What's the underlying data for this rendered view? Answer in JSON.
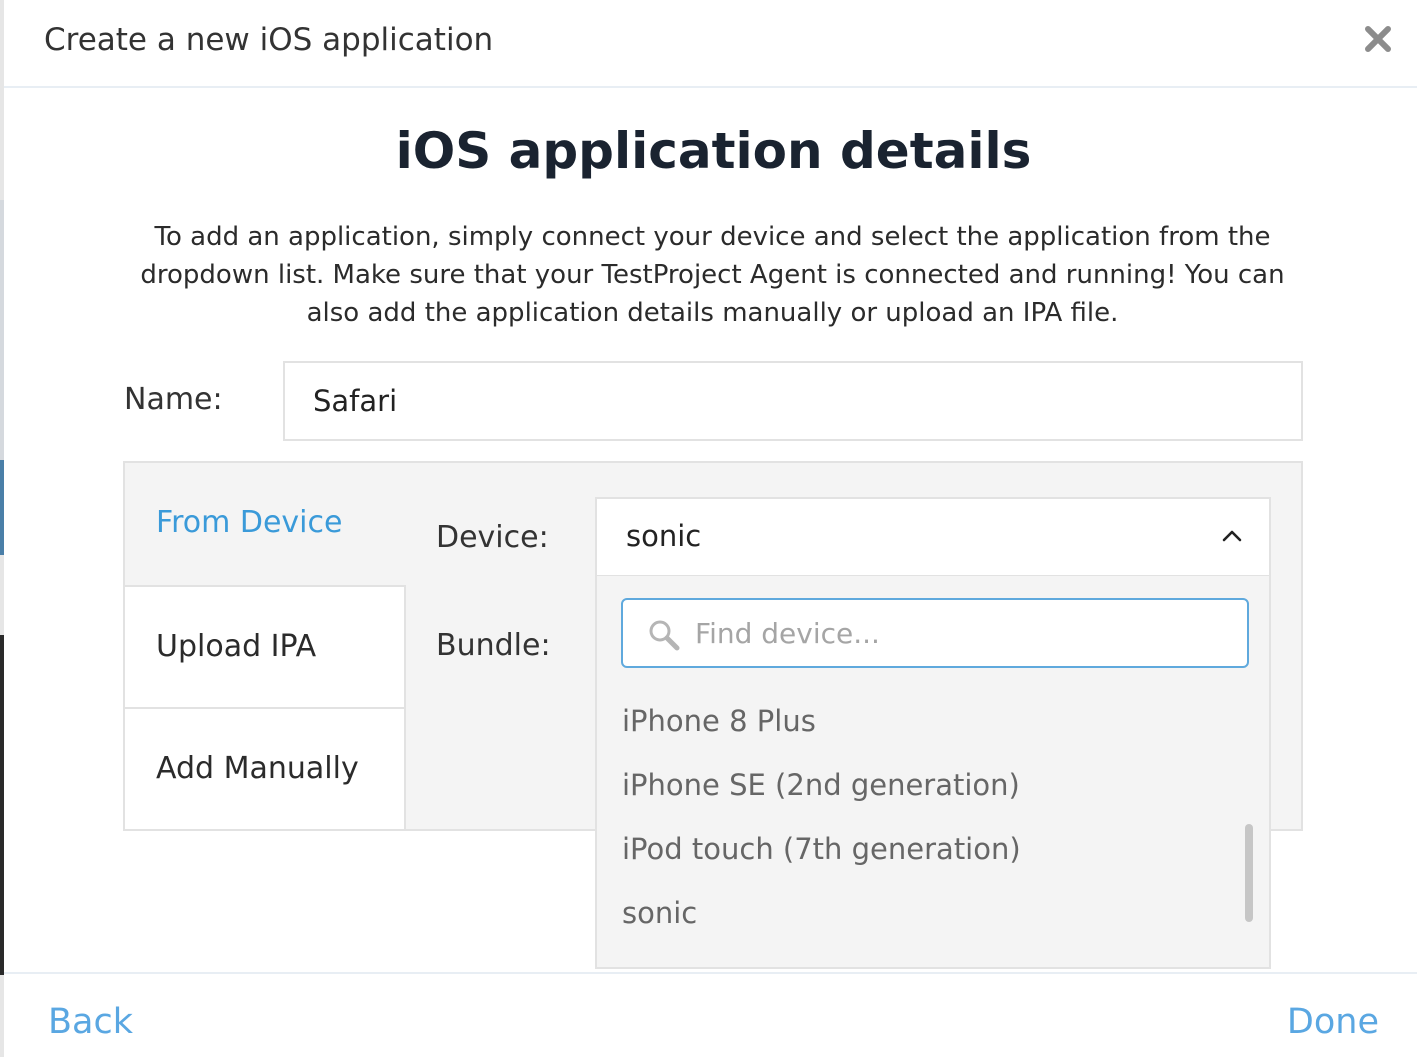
{
  "dialog": {
    "title": "Create a new iOS application",
    "close_icon": "close-icon"
  },
  "content": {
    "heading": "iOS application details",
    "description": "To add an application, simply connect your device and select the application from the dropdown list. Make sure that your TestProject Agent is connected and running! You can also add the application details manually or upload an IPA file."
  },
  "name_field": {
    "label": "Name:",
    "value": "Safari"
  },
  "tabs": [
    {
      "label": "From Device",
      "active": true
    },
    {
      "label": "Upload IPA",
      "active": false
    },
    {
      "label": "Add Manually",
      "active": false
    }
  ],
  "device_field": {
    "label": "Device:",
    "selected": "sonic",
    "icon": "chevron-up-icon",
    "search_placeholder": "Find device...",
    "search_icon": "search-icon",
    "options": [
      "iPhone 8 Plus",
      "iPhone SE (2nd generation)",
      "iPod touch (7th generation)",
      "sonic"
    ]
  },
  "bundle_field": {
    "label": "Bundle:"
  },
  "footer": {
    "back_label": "Back",
    "done_label": "Done"
  },
  "colors": {
    "accent": "#5aa7e2",
    "active_tab": "#3a9ad9",
    "panel_bg": "#f4f4f4",
    "border": "#e2e2e2"
  }
}
